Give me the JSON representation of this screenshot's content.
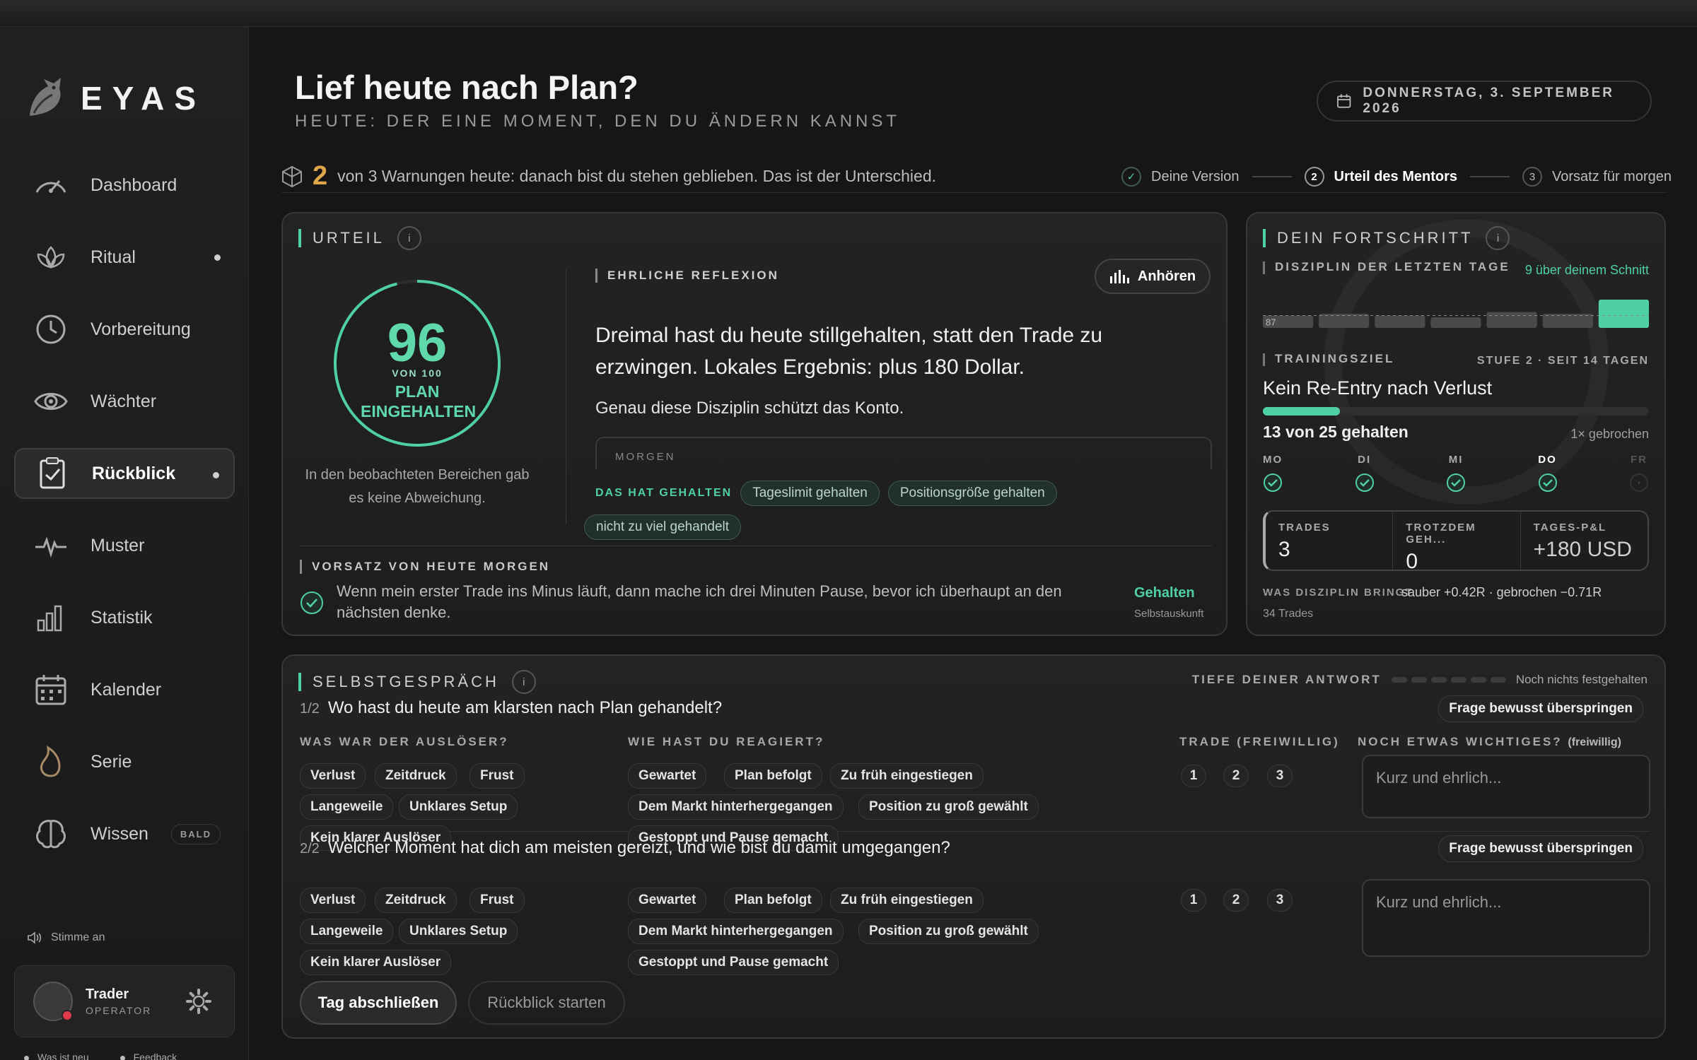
{
  "app": {
    "name": "EYAS"
  },
  "sidebar": {
    "items": [
      {
        "label": "Dashboard",
        "icon": "gauge-icon"
      },
      {
        "label": "Ritual",
        "icon": "lotus-icon"
      },
      {
        "label": "Vorbereitung",
        "icon": "clock-icon"
      },
      {
        "label": "Wächter",
        "icon": "eye-icon"
      },
      {
        "label": "Rückblick",
        "icon": "clipboard-check-icon"
      },
      {
        "label": "Muster",
        "icon": "pulse-icon"
      },
      {
        "label": "Statistik",
        "icon": "bar-chart-icon"
      },
      {
        "label": "Kalender",
        "icon": "calendar-icon"
      },
      {
        "label": "Serie",
        "icon": "flame-icon"
      },
      {
        "label": "Wissen",
        "icon": "brain-icon",
        "badge": "BALD"
      }
    ],
    "active": "Rückblick",
    "voice": "Stimme an",
    "user": {
      "name": "Trader",
      "role": "OPERATOR"
    },
    "footer": {
      "news": "Was ist neu",
      "feedback": "Feedback"
    }
  },
  "header": {
    "title": "Lief heute nach Plan?",
    "subtitle": "HEUTE: DER EINE MOMENT, DEN DU ÄNDERN KANNST",
    "date": "DONNERSTAG, 3. SEPTEMBER 2026"
  },
  "warning": {
    "count": "2",
    "text": "von 3 Warnungen heute: danach bist du stehen geblieben. Das ist der Unterschied."
  },
  "steps": [
    {
      "num": "✓",
      "label": "Deine Version"
    },
    {
      "num": "2",
      "label": "Urteil des Mentors"
    },
    {
      "num": "3",
      "label": "Vorsatz für morgen"
    }
  ],
  "urteil": {
    "title": "URTEIL",
    "score": "96",
    "score_of": "VON 100",
    "score_label": "PLAN EINGEHALTEN",
    "score_value": 0.96,
    "note": "In den beobachteten Bereichen gab es keine Abweichung.",
    "reflection_tag": "EHRLICHE REFLEXION",
    "listen": "Anhören",
    "reflection": "Dreimal hast du heute stillgehalten, statt den Trade zu erzwingen. Lokales Ergebnis: plus 180 Dollar.",
    "reflection_sub": "Genau diese Disziplin schützt das Konto.",
    "morgen": "MORGEN",
    "held_label": "DAS HAT GEHALTEN",
    "held": [
      "Tageslimit gehalten",
      "Positionsgröße gehalten",
      "nicht zu viel gehandelt"
    ],
    "vorsatz_tag": "VORSATZ VON HEUTE MORGEN",
    "vorsatz": "Wenn mein erster Trade ins Minus läuft, dann mache ich drei Minuten Pause, bevor ich überhaupt an den nächsten denke.",
    "vorsatz_status": "Gehalten",
    "vorsatz_source": "Selbstauskunft"
  },
  "fortschritt": {
    "title": "DEIN FORTSCHRITT",
    "disziplin_label": "DISZIPLIN DER LETZTEN TAGE",
    "above": "9 über deinem Schnitt",
    "baseline": "87",
    "training_label": "TRAININGSZIEL",
    "stage": "STUFE 2 · SEIT 14 TAGEN",
    "goal": "Kein Re-Entry nach Verlust",
    "goal_progress": 0.2,
    "count": "13 von 25 gehalten",
    "broken": "1× gebrochen",
    "days": [
      {
        "d": "MO",
        "ok": true
      },
      {
        "d": "DI",
        "ok": true
      },
      {
        "d": "MI",
        "ok": true
      },
      {
        "d": "DO",
        "ok": true
      },
      {
        "d": "FR",
        "ok": false
      }
    ],
    "stats": [
      {
        "label": "TRADES",
        "value": "3"
      },
      {
        "label": "TROTZDEM GEH...",
        "value": "0"
      },
      {
        "label": "TAGES-P&L",
        "value": "+180 USD"
      }
    ],
    "brings_label": "WAS DISZIPLIN BRINGT",
    "brings_value": "sauber +0.42R · gebrochen −0.71R",
    "trades_total": "34 Trades"
  },
  "selbst": {
    "title": "SELBSTGESPRÄCH",
    "depth_label": "TIEFE DEINER ANTWORT",
    "depth_status": "Noch nichts festgehalten",
    "col_trigger": "WAS WAR DER AUSLÖSER?",
    "col_reaction": "WIE HAST DU REAGIERT?",
    "col_trade": "TRADE (FREIWILLIG)",
    "col_extra": "NOCH ETWAS WICHTIGES?",
    "col_extra_opt": "(freiwillig)",
    "skip": "Frage bewusst überspringen",
    "placeholder": "Kurz und ehrlich...",
    "triggers": [
      "Verlust",
      "Zeitdruck",
      "Frust",
      "Langeweile",
      "Unklares Setup",
      "Kein klarer Auslöser"
    ],
    "reactions": [
      "Gewartet",
      "Plan befolgt",
      "Zu früh eingestiegen",
      "Dem Markt hinterhergegangen",
      "Position zu groß gewählt",
      "Gestoppt und Pause gemacht"
    ],
    "trades": [
      "1",
      "2",
      "3"
    ],
    "questions": [
      {
        "num": "1/2",
        "text": "Wo hast du heute am klarsten nach Plan gehandelt?"
      },
      {
        "num": "2/2",
        "text": "Welcher Moment hat dich am meisten gereizt, und wie bist du damit umgegangen?"
      }
    ],
    "finish": "Tag abschließen",
    "start_review": "Rückblick starten"
  },
  "chart_data": {
    "type": "bar",
    "values": [
      87,
      88,
      87,
      86,
      89,
      88,
      96
    ],
    "baseline": 87
  },
  "colors": {
    "accent": "#4fd0a4",
    "warning": "#e0a64a",
    "alert": "#e0394a"
  }
}
